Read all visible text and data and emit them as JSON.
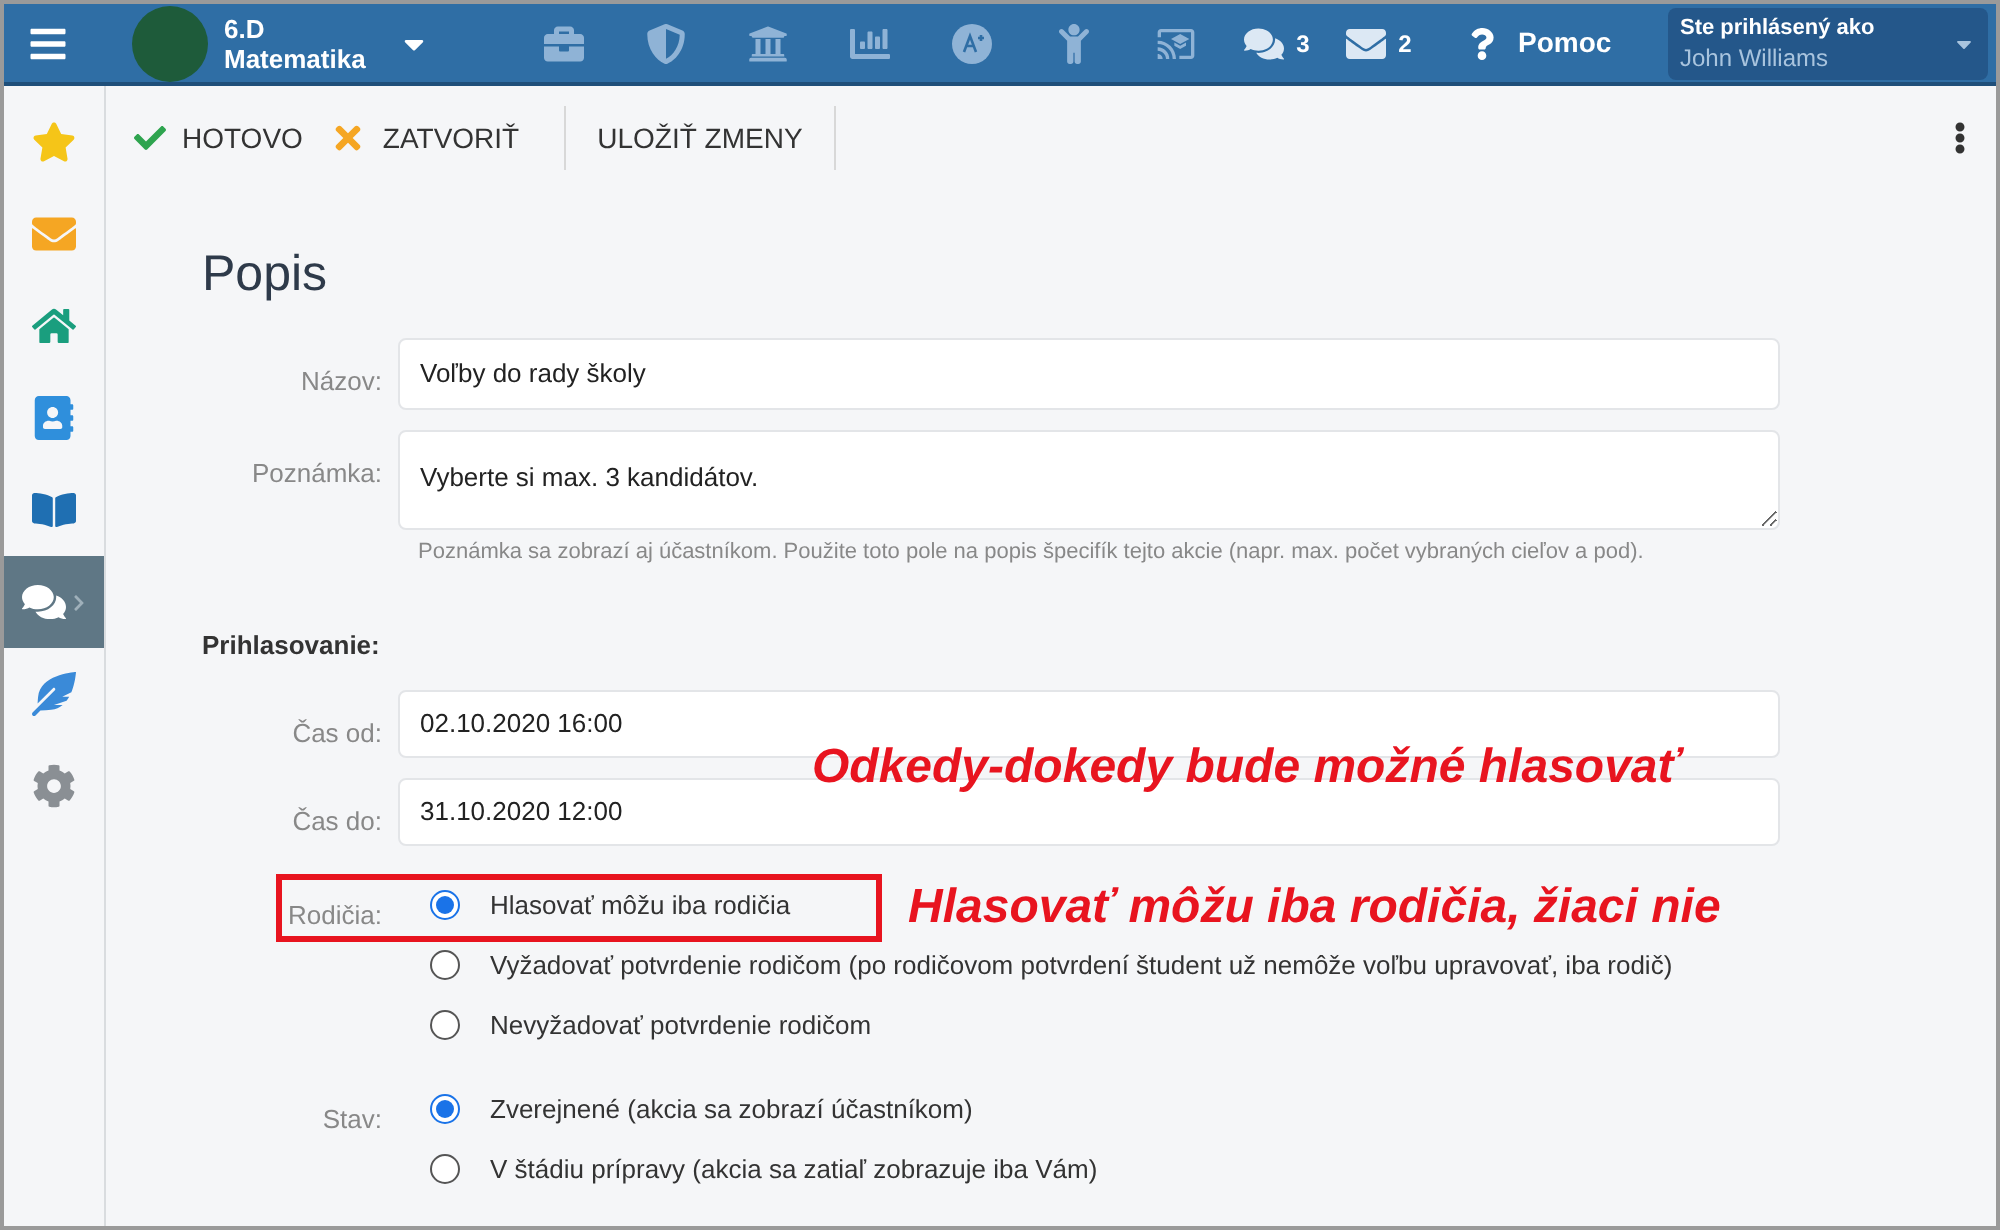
{
  "top_bar": {
    "class_title": "6.D",
    "class_subtitle": "Matematika",
    "nav_icons": [
      {
        "kind": "briefcase"
      },
      {
        "kind": "shield"
      },
      {
        "kind": "bank"
      },
      {
        "kind": "chart"
      },
      {
        "kind": "grade"
      },
      {
        "kind": "kids"
      },
      {
        "kind": "cast"
      },
      {
        "kind": "chat",
        "count": "3"
      },
      {
        "kind": "mail",
        "count": "2"
      }
    ],
    "help": "Pomoc",
    "user_label": "Ste prihlásený ako",
    "user_name": "John Williams"
  },
  "sidebar": {
    "items": [
      {
        "kind": "star",
        "selected": false
      },
      {
        "kind": "mail",
        "selected": false
      },
      {
        "kind": "home",
        "selected": false
      },
      {
        "kind": "notebook",
        "selected": false
      },
      {
        "kind": "book",
        "selected": false
      },
      {
        "kind": "chat",
        "selected": true
      },
      {
        "kind": "pen",
        "selected": false
      },
      {
        "kind": "gear",
        "selected": false
      }
    ]
  },
  "toolbar": [
    {
      "kind": "done",
      "label": "HOTOVO"
    },
    {
      "kind": "close",
      "label": "ZATVORIŤ"
    },
    {
      "kind": "save",
      "label": "ULOŽIŤ ZMENY"
    }
  ],
  "form": {
    "heading": "Popis",
    "name": {
      "label": "Názov:",
      "value": "Voľby do rady školy"
    },
    "note": {
      "label": "Poznámka:",
      "value": "Vyberte si max. 3 kandidátov.",
      "hint": "Poznámka sa zobrazí aj účastníkom. Použite toto pole na popis špecifík tejto akcie (napr. max. počet vybraných cieľov a pod)."
    },
    "section": "Prihlasovanie:",
    "time_from": {
      "label": "Čas od:",
      "value": "02.10.2020 16:00"
    },
    "time_to": {
      "label": "Čas do:",
      "value": "31.10.2020 12:00"
    },
    "radio_groups": [
      {
        "label": "Rodičia:",
        "options": [
          {
            "label": "Hlasovať môžu iba rodičia",
            "selected": true
          },
          {
            "label": "Vyžadovať potvrdenie rodičom (po rodičovom potvrdení študent už nemôže voľbu upravovať, iba rodič)",
            "selected": false
          },
          {
            "label": "Nevyžadovať potvrdenie rodičom",
            "selected": false
          }
        ]
      },
      {
        "label": "Stav:",
        "options": [
          {
            "label": "Zverejnené (akcia sa zobrazí účastníkom)",
            "selected": true
          },
          {
            "label": "V štádiu prípravy (akcia sa zatiaľ zobrazuje iba Vám)",
            "selected": false
          }
        ]
      }
    ]
  },
  "annotations": [
    {
      "text": "Odkedy-dokedy bude možné hlasovať"
    },
    {
      "text": "Hlasovať môžu iba rodičia, žiaci nie"
    }
  ]
}
